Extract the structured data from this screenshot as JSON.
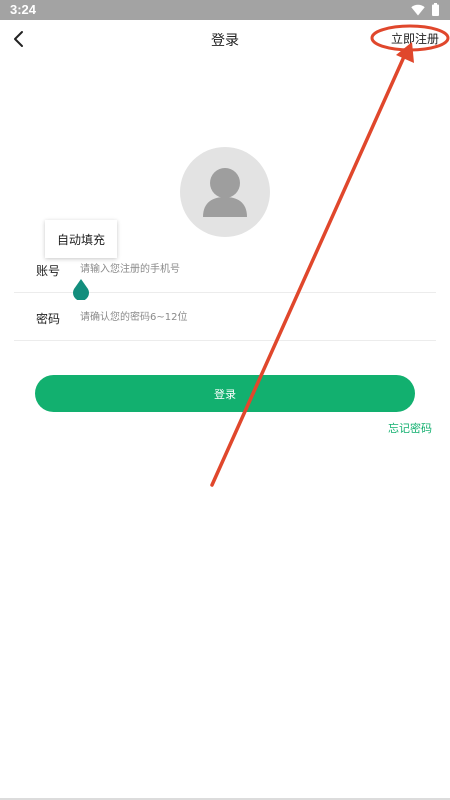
{
  "status_bar": {
    "time": "3:24",
    "background": "#a3a3a3",
    "icons": [
      "wifi-icon",
      "battery-icon"
    ]
  },
  "app_bar": {
    "back_icon": "back-chevron-icon",
    "title": "登录",
    "register_label": "立即注册"
  },
  "avatar": {
    "icon": "user-silhouette-icon"
  },
  "autofill": {
    "label": "自动填充"
  },
  "form": {
    "account": {
      "label": "账号",
      "placeholder": "请输入您注册的手机号",
      "value": ""
    },
    "password": {
      "label": "密码",
      "placeholder": "请确认您的密码6~12位",
      "value": ""
    }
  },
  "actions": {
    "login_label": "登录",
    "forgot_label": "忘记密码"
  },
  "colors": {
    "accent": "#12b06f",
    "text_handle": "#138e7d",
    "annotation": "#e0472c"
  }
}
